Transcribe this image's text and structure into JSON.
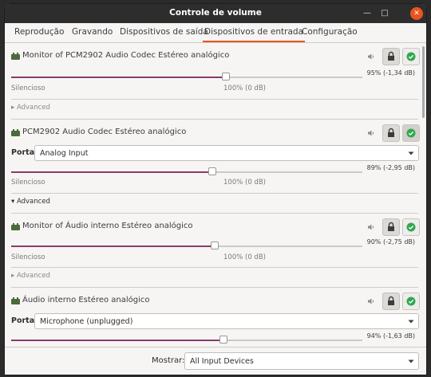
{
  "window": {
    "title": "Controle de volume"
  },
  "tabs": [
    {
      "label": "Reprodução"
    },
    {
      "label": "Gravando"
    },
    {
      "label": "Dispositivos de saída"
    },
    {
      "label": "Dispositivos de entrada",
      "active": true
    },
    {
      "label": "Configuração"
    }
  ],
  "devices": [
    {
      "name": "Monitor of PCM2902 Audio Codec Estéreo analógico",
      "volume_readout": "95% (-1,34 dB)",
      "volume_percent": 95,
      "advanced_label": "Advanced",
      "advanced_expanded": false,
      "ok_active": false
    },
    {
      "name": "PCM2902 Audio Codec Estéreo analógico",
      "port_label": "Porta:",
      "port_value": "Analog Input",
      "volume_readout": "89% (-2,95 dB)",
      "volume_percent": 89,
      "advanced_label": "Advanced",
      "advanced_expanded": true,
      "ok_active": true
    },
    {
      "name": "Monitor of Áudio interno Estéreo analógico",
      "volume_readout": "90% (-2,75 dB)",
      "volume_percent": 90,
      "advanced_label": "Advanced",
      "advanced_expanded": false,
      "ok_active": false
    },
    {
      "name": "Áudio interno Estéreo analógico",
      "port_label": "Porta:",
      "port_value": "Microphone (unplugged)",
      "volume_readout": "94% (-1,63 dB)",
      "volume_percent": 94,
      "ok_active": false
    }
  ],
  "slider_marks": {
    "silent": "Silencioso",
    "hundred": "100% (0 dB)"
  },
  "footer": {
    "show_label": "Mostrar:",
    "show_value": "All Input Devices"
  },
  "colors": {
    "accent": "#e95420",
    "slider_fill": "#8a3a6e",
    "ok_check": "#2fa84f",
    "titlebar": "#2d2d2d"
  }
}
